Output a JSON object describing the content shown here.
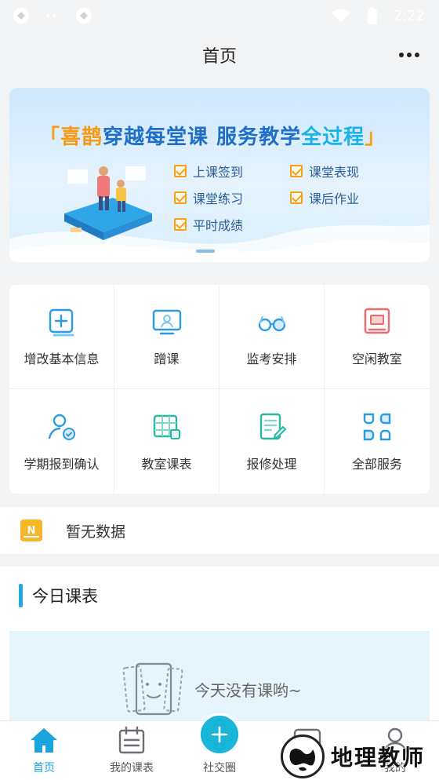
{
  "status_bar": {
    "time": "2:22"
  },
  "header": {
    "title": "首页"
  },
  "banner": {
    "headline_parts": [
      "「",
      "喜鹊",
      "穿越每堂课 服务教学",
      "全过程",
      "」"
    ],
    "features": [
      "上课签到",
      "课堂表现",
      "课堂练习",
      "课后作业",
      "平时成绩"
    ]
  },
  "services": [
    {
      "label": "增改基本信息",
      "icon": "add-info-icon"
    },
    {
      "label": "蹭课",
      "icon": "screen-user-icon"
    },
    {
      "label": "监考安排",
      "icon": "glasses-icon"
    },
    {
      "label": "空闲教室",
      "icon": "classroom-icon"
    },
    {
      "label": "学期报到确认",
      "icon": "user-check-icon"
    },
    {
      "label": "教室课表",
      "icon": "timetable-icon"
    },
    {
      "label": "报修处理",
      "icon": "repair-form-icon"
    },
    {
      "label": "全部服务",
      "icon": "all-services-icon"
    }
  ],
  "notice": {
    "badge": "N",
    "text": "暂无数据"
  },
  "schedule": {
    "title": "今日课表",
    "empty_text": "今天没有课哟~"
  },
  "tabs": [
    {
      "label": "首页",
      "active": true
    },
    {
      "label": "我的课表",
      "active": false
    },
    {
      "label": "社交圈",
      "active": false
    },
    {
      "label": "消息",
      "active": false
    },
    {
      "label": "我的",
      "active": false
    }
  ],
  "watermark": {
    "text": "地理教师"
  },
  "colors": {
    "accent": "#1aa3dd",
    "brand_orange": "#f4a21a",
    "plus": "#1ab6d9"
  }
}
